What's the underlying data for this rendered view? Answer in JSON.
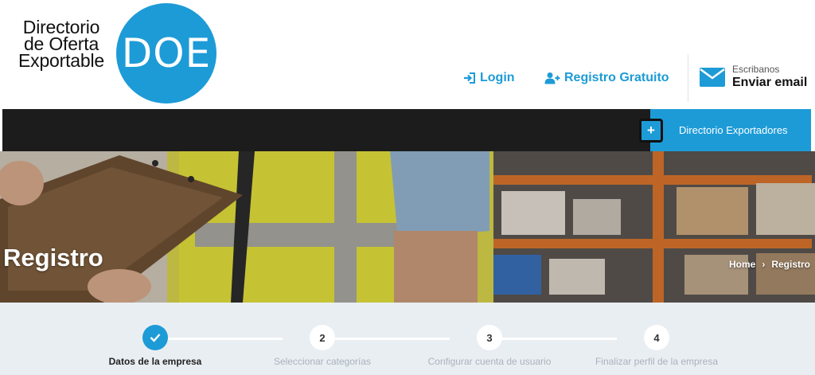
{
  "logo": {
    "line1": "Directorio",
    "line2": "de Oferta",
    "line3": "Exportable",
    "badge": "DOE"
  },
  "header": {
    "login_label": "Login",
    "register_label": "Registro Gratuito",
    "email_small": "Escribanos",
    "email_big": "Enviar email"
  },
  "navbar": {
    "plus_label": "+",
    "directory_label": "Directorio Exportadores"
  },
  "hero": {
    "title": "Registro",
    "breadcrumb_home": "Home",
    "breadcrumb_sep": "›",
    "breadcrumb_current": "Registro"
  },
  "steps": [
    {
      "number": "",
      "label": "Datos de la empresa",
      "state": "complete"
    },
    {
      "number": "2",
      "label": "Seleccionar categorías",
      "state": "pending"
    },
    {
      "number": "3",
      "label": "Configurar cuenta de usuario",
      "state": "pending"
    },
    {
      "number": "4",
      "label": "Finalizar perfil de la empresa",
      "state": "pending"
    }
  ],
  "colors": {
    "accent": "#1d9bd7",
    "navbar": "#1c1c1c",
    "steps_bg": "#e9eef3"
  }
}
